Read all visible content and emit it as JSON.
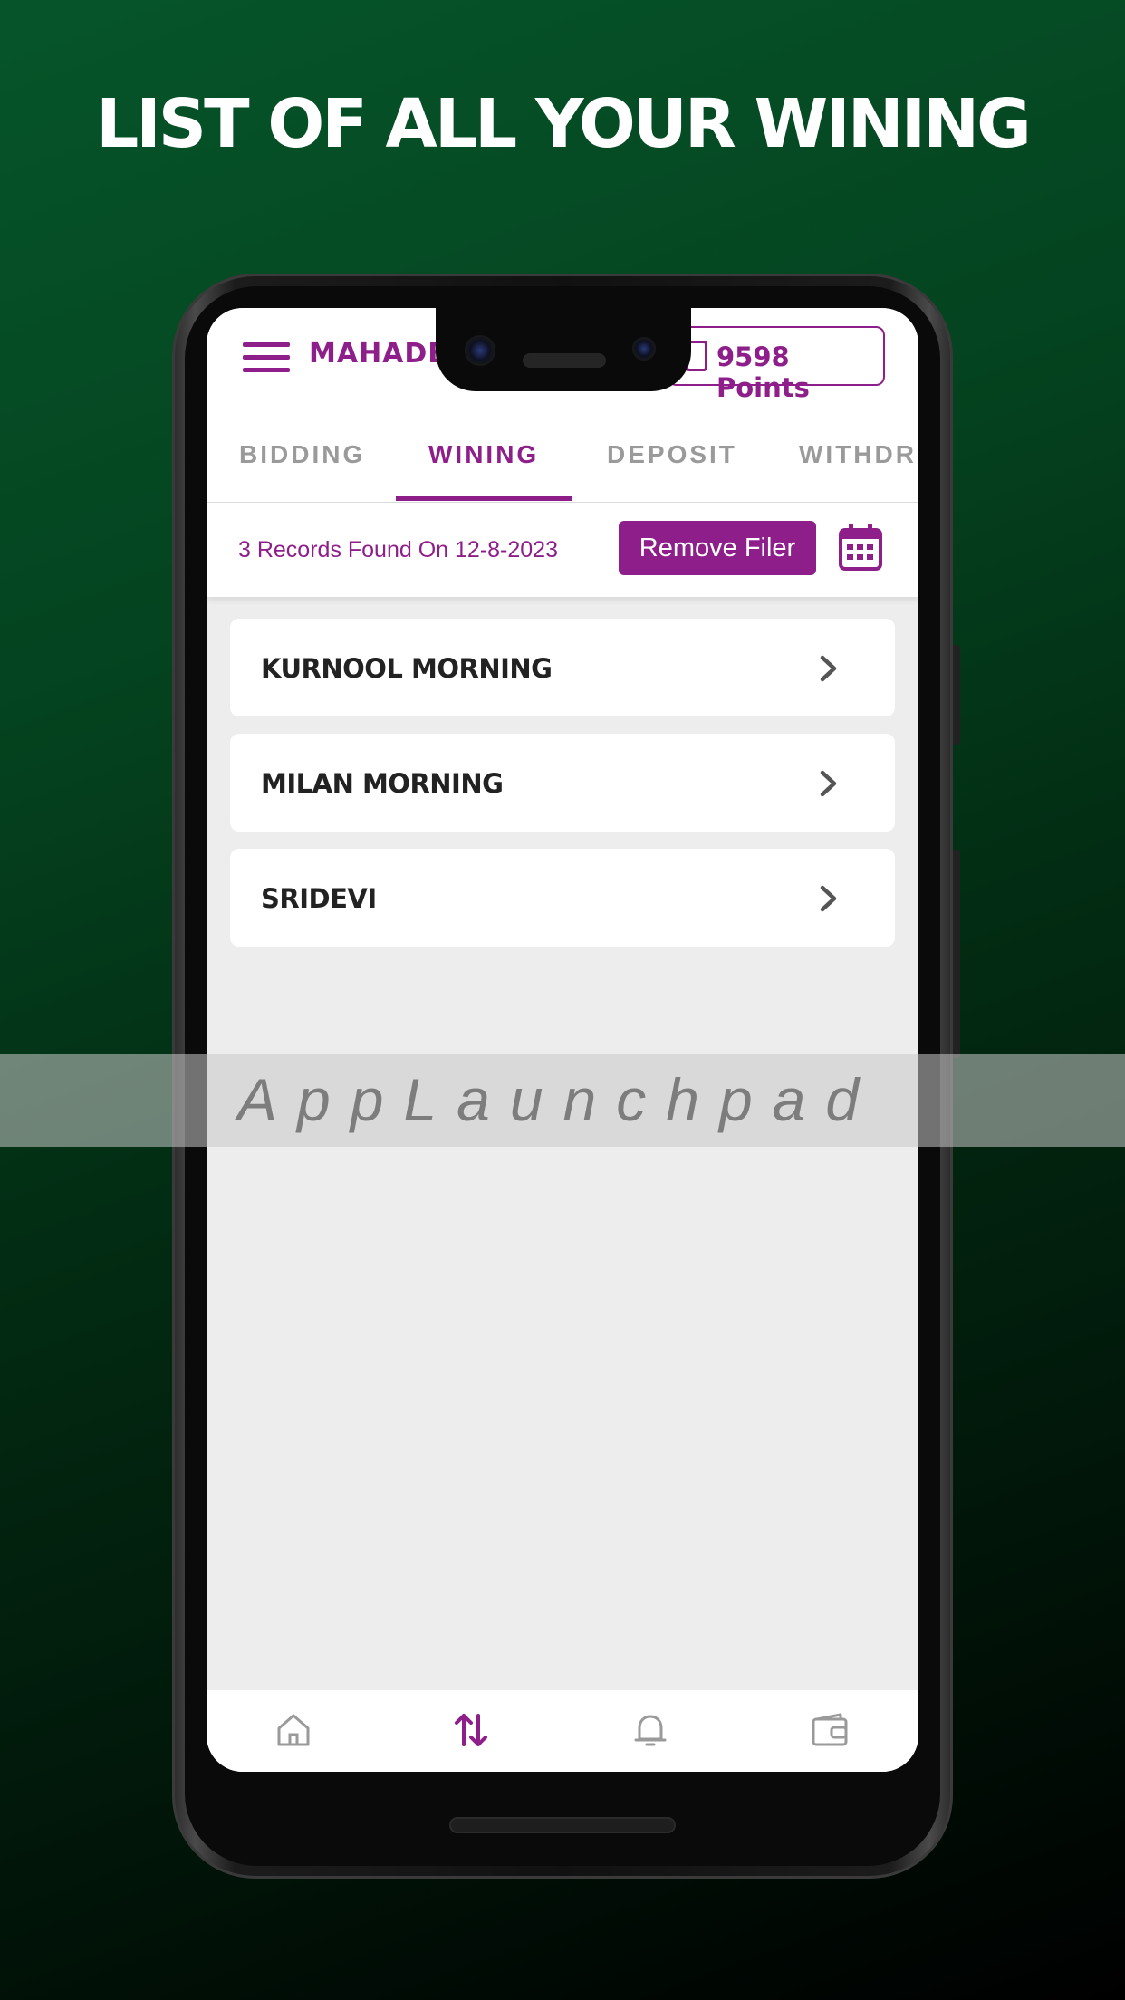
{
  "headline": "LIST OF ALL YOUR WINING",
  "app": {
    "brand": "MAHADE",
    "points": "9598 Points",
    "accent_color": "#8e1f8a"
  },
  "tabs": [
    {
      "label": "BIDDING",
      "active": false
    },
    {
      "label": "WINING",
      "active": true
    },
    {
      "label": "DEPOSIT",
      "active": false
    },
    {
      "label": "WITHDR",
      "active": false
    }
  ],
  "filter": {
    "records_text": "3 Records Found On 12-8-2023",
    "remove_button_label": "Remove Filer",
    "calendar_icon": "calendar-icon"
  },
  "winnings": [
    {
      "name": "KURNOOL MORNING"
    },
    {
      "name": "MILAN MORNING"
    },
    {
      "name": "SRIDEVI"
    }
  ],
  "watermark": "AppLaunchpad",
  "bottom_nav": [
    {
      "icon": "home-icon",
      "active": false
    },
    {
      "icon": "transfer-arrows-icon",
      "active": true
    },
    {
      "icon": "bell-icon",
      "active": false
    },
    {
      "icon": "wallet-icon",
      "active": false
    }
  ]
}
